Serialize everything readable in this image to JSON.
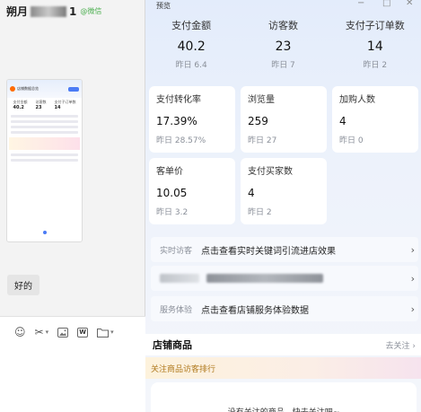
{
  "chat": {
    "name_prefix": "朔月",
    "name_suffix": "1",
    "tag": "@微信",
    "bubble": "好的",
    "thumbnail": {
      "title": "店铺数据总览",
      "stats": [
        {
          "label": "支付金额",
          "value": "40.2"
        },
        {
          "label": "访客数",
          "value": "23"
        },
        {
          "label": "支付子订单数",
          "value": "14"
        }
      ]
    }
  },
  "window": {
    "title": "预览",
    "controls": {
      "minimize": "−",
      "maximize": "□",
      "close": "✕"
    }
  },
  "top_stats": [
    {
      "label": "支付金额",
      "value": "40.2",
      "sub": "昨日 6.4"
    },
    {
      "label": "访客数",
      "value": "23",
      "sub": "昨日 7"
    },
    {
      "label": "支付子订单数",
      "value": "14",
      "sub": "昨日 2"
    }
  ],
  "cards": [
    {
      "label": "支付转化率",
      "value": "17.39%",
      "sub": "昨日 28.57%"
    },
    {
      "label": "浏览量",
      "value": "259",
      "sub": "昨日 27"
    },
    {
      "label": "加购人数",
      "value": "4",
      "sub": "昨日 0"
    },
    {
      "label": "客单价",
      "value": "10.05",
      "sub": "昨日 3.2"
    },
    {
      "label": "支付买家数",
      "value": "4",
      "sub": "昨日 2"
    }
  ],
  "rows": [
    {
      "label": "实时访客",
      "text": "点击查看实时关键词引流进店效果",
      "arrow": "›"
    },
    {
      "label": "",
      "text": "",
      "arrow": "›"
    },
    {
      "label": "服务体验",
      "text": "点击查看店铺服务体验数据",
      "arrow": "›"
    }
  ],
  "section": {
    "title": "店铺商品",
    "link": "去关注 ›"
  },
  "rank_band": {
    "text": "关注商品访客排行"
  },
  "empty": {
    "text": "没有关注的商品，快去关注吧~"
  },
  "compose": {
    "tools": [
      "emoji-icon",
      "scissors-icon",
      "image-icon",
      "word-icon",
      "folder-icon"
    ],
    "word_label": "W"
  },
  "colors": {
    "accent": "#4b7bf5",
    "tag_green": "#4caf50",
    "rank_text": "#b07a1e"
  }
}
